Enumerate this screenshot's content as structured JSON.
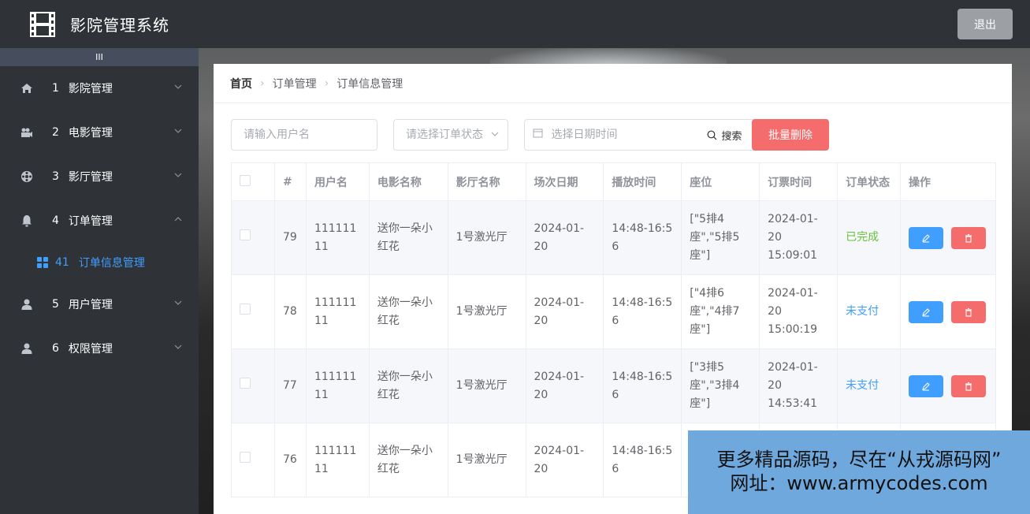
{
  "header": {
    "title": "影院管理系统",
    "logout_label": "退出"
  },
  "sidebar": {
    "collapse_label": "III",
    "items": [
      {
        "num": "1",
        "label": "影院管理",
        "icon": "home-icon",
        "expanded": false
      },
      {
        "num": "2",
        "label": "电影管理",
        "icon": "camera-icon",
        "expanded": false
      },
      {
        "num": "3",
        "label": "影厅管理",
        "icon": "film-reel-icon",
        "expanded": false
      },
      {
        "num": "4",
        "label": "订单管理",
        "icon": "bell-icon",
        "expanded": true,
        "children": [
          {
            "num": "41",
            "label": "订单信息管理",
            "icon": "grid-icon"
          }
        ]
      },
      {
        "num": "5",
        "label": "用户管理",
        "icon": "user-icon",
        "expanded": false
      },
      {
        "num": "6",
        "label": "权限管理",
        "icon": "user-icon",
        "expanded": false
      }
    ]
  },
  "breadcrumb": [
    "首页",
    "订单管理",
    "订单信息管理"
  ],
  "filters": {
    "username_placeholder": "请输入用户名",
    "status_placeholder": "请选择订单状态",
    "date_placeholder": "选择日期时间",
    "search_label": "搜索",
    "batch_delete_label": "批量删除"
  },
  "table": {
    "columns": [
      "#",
      "用户名",
      "电影名称",
      "影厅名称",
      "场次日期",
      "播放时间",
      "座位",
      "订票时间",
      "订单状态",
      "操作"
    ],
    "rows": [
      {
        "id": "79",
        "username": "11111111",
        "movie": "送你一朵小红花",
        "hall": "1号激光厅",
        "date": "2024-01-20",
        "time": "14:48-16:56",
        "seats": "[\"5排4座\",\"5排5座\"]",
        "booked": "2024-01-20 15:09:01",
        "status": "已完成",
        "status_kind": "done"
      },
      {
        "id": "78",
        "username": "11111111",
        "movie": "送你一朵小红花",
        "hall": "1号激光厅",
        "date": "2024-01-20",
        "time": "14:48-16:56",
        "seats": "[\"4排6座\",\"4排7座\"]",
        "booked": "2024-01-20 15:00:19",
        "status": "未支付",
        "status_kind": "unpaid"
      },
      {
        "id": "77",
        "username": "11111111",
        "movie": "送你一朵小红花",
        "hall": "1号激光厅",
        "date": "2024-01-20",
        "time": "14:48-16:56",
        "seats": "[\"3排5座\",\"3排4座\"]",
        "booked": "2024-01-20 14:53:41",
        "status": "未支付",
        "status_kind": "unpaid"
      },
      {
        "id": "76",
        "username": "11111111",
        "movie": "送你一朵小红花",
        "hall": "1号激光厅",
        "date": "2024-01-20",
        "time": "14:48-16:56",
        "seats": "",
        "booked": "",
        "status": "",
        "status_kind": ""
      }
    ]
  },
  "watermark": {
    "line1": "更多精品源码，尽在“从戎源码网”",
    "line2": "网址：www.armycodes.com"
  },
  "colors": {
    "primary": "#409eff",
    "danger": "#f56c6c",
    "success": "#67c23a",
    "sidebar": "#2f3237"
  }
}
